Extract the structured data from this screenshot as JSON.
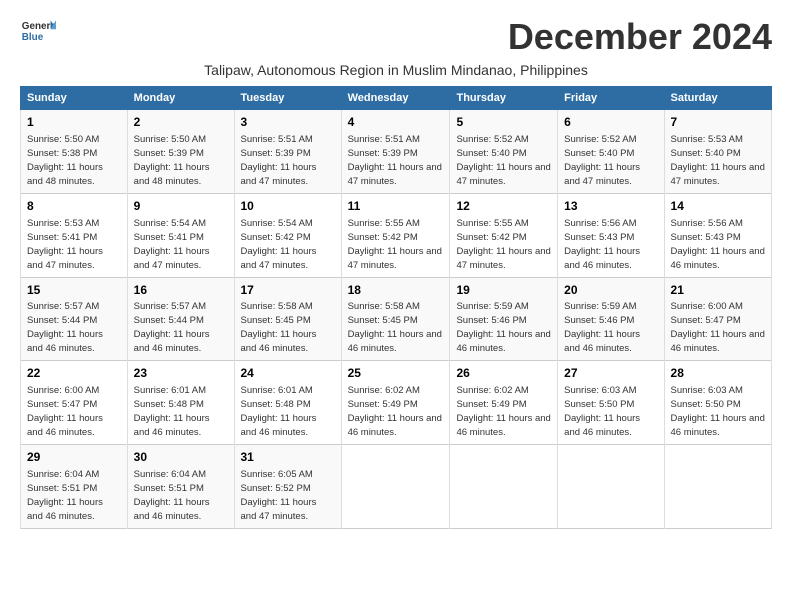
{
  "header": {
    "logo_line1": "General",
    "logo_line2": "Blue",
    "month_title": "December 2024",
    "location": "Talipaw, Autonomous Region in Muslim Mindanao, Philippines"
  },
  "columns": [
    "Sunday",
    "Monday",
    "Tuesday",
    "Wednesday",
    "Thursday",
    "Friday",
    "Saturday"
  ],
  "weeks": [
    [
      {
        "day": "1",
        "sunrise": "5:50 AM",
        "sunset": "5:38 PM",
        "daylight": "11 hours and 48 minutes."
      },
      {
        "day": "2",
        "sunrise": "5:50 AM",
        "sunset": "5:39 PM",
        "daylight": "11 hours and 48 minutes."
      },
      {
        "day": "3",
        "sunrise": "5:51 AM",
        "sunset": "5:39 PM",
        "daylight": "11 hours and 47 minutes."
      },
      {
        "day": "4",
        "sunrise": "5:51 AM",
        "sunset": "5:39 PM",
        "daylight": "11 hours and 47 minutes."
      },
      {
        "day": "5",
        "sunrise": "5:52 AM",
        "sunset": "5:40 PM",
        "daylight": "11 hours and 47 minutes."
      },
      {
        "day": "6",
        "sunrise": "5:52 AM",
        "sunset": "5:40 PM",
        "daylight": "11 hours and 47 minutes."
      },
      {
        "day": "7",
        "sunrise": "5:53 AM",
        "sunset": "5:40 PM",
        "daylight": "11 hours and 47 minutes."
      }
    ],
    [
      {
        "day": "8",
        "sunrise": "5:53 AM",
        "sunset": "5:41 PM",
        "daylight": "11 hours and 47 minutes."
      },
      {
        "day": "9",
        "sunrise": "5:54 AM",
        "sunset": "5:41 PM",
        "daylight": "11 hours and 47 minutes."
      },
      {
        "day": "10",
        "sunrise": "5:54 AM",
        "sunset": "5:42 PM",
        "daylight": "11 hours and 47 minutes."
      },
      {
        "day": "11",
        "sunrise": "5:55 AM",
        "sunset": "5:42 PM",
        "daylight": "11 hours and 47 minutes."
      },
      {
        "day": "12",
        "sunrise": "5:55 AM",
        "sunset": "5:42 PM",
        "daylight": "11 hours and 47 minutes."
      },
      {
        "day": "13",
        "sunrise": "5:56 AM",
        "sunset": "5:43 PM",
        "daylight": "11 hours and 46 minutes."
      },
      {
        "day": "14",
        "sunrise": "5:56 AM",
        "sunset": "5:43 PM",
        "daylight": "11 hours and 46 minutes."
      }
    ],
    [
      {
        "day": "15",
        "sunrise": "5:57 AM",
        "sunset": "5:44 PM",
        "daylight": "11 hours and 46 minutes."
      },
      {
        "day": "16",
        "sunrise": "5:57 AM",
        "sunset": "5:44 PM",
        "daylight": "11 hours and 46 minutes."
      },
      {
        "day": "17",
        "sunrise": "5:58 AM",
        "sunset": "5:45 PM",
        "daylight": "11 hours and 46 minutes."
      },
      {
        "day": "18",
        "sunrise": "5:58 AM",
        "sunset": "5:45 PM",
        "daylight": "11 hours and 46 minutes."
      },
      {
        "day": "19",
        "sunrise": "5:59 AM",
        "sunset": "5:46 PM",
        "daylight": "11 hours and 46 minutes."
      },
      {
        "day": "20",
        "sunrise": "5:59 AM",
        "sunset": "5:46 PM",
        "daylight": "11 hours and 46 minutes."
      },
      {
        "day": "21",
        "sunrise": "6:00 AM",
        "sunset": "5:47 PM",
        "daylight": "11 hours and 46 minutes."
      }
    ],
    [
      {
        "day": "22",
        "sunrise": "6:00 AM",
        "sunset": "5:47 PM",
        "daylight": "11 hours and 46 minutes."
      },
      {
        "day": "23",
        "sunrise": "6:01 AM",
        "sunset": "5:48 PM",
        "daylight": "11 hours and 46 minutes."
      },
      {
        "day": "24",
        "sunrise": "6:01 AM",
        "sunset": "5:48 PM",
        "daylight": "11 hours and 46 minutes."
      },
      {
        "day": "25",
        "sunrise": "6:02 AM",
        "sunset": "5:49 PM",
        "daylight": "11 hours and 46 minutes."
      },
      {
        "day": "26",
        "sunrise": "6:02 AM",
        "sunset": "5:49 PM",
        "daylight": "11 hours and 46 minutes."
      },
      {
        "day": "27",
        "sunrise": "6:03 AM",
        "sunset": "5:50 PM",
        "daylight": "11 hours and 46 minutes."
      },
      {
        "day": "28",
        "sunrise": "6:03 AM",
        "sunset": "5:50 PM",
        "daylight": "11 hours and 46 minutes."
      }
    ],
    [
      {
        "day": "29",
        "sunrise": "6:04 AM",
        "sunset": "5:51 PM",
        "daylight": "11 hours and 46 minutes."
      },
      {
        "day": "30",
        "sunrise": "6:04 AM",
        "sunset": "5:51 PM",
        "daylight": "11 hours and 46 minutes."
      },
      {
        "day": "31",
        "sunrise": "6:05 AM",
        "sunset": "5:52 PM",
        "daylight": "11 hours and 47 minutes."
      },
      null,
      null,
      null,
      null
    ]
  ]
}
